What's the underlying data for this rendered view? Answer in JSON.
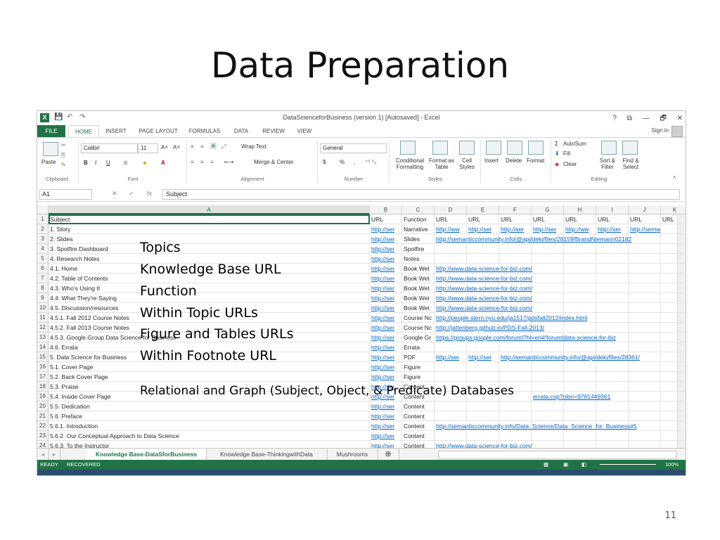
{
  "slide": {
    "title": "Data Preparation",
    "page_number": "11"
  },
  "excel": {
    "window_title": "DataScienceforBusiness (version 1) [Autosaved] - Excel",
    "window_controls": [
      "?",
      "⧉",
      "—",
      "🗗",
      "✕"
    ],
    "ribbon_tabs": [
      "FILE",
      "HOME",
      "INSERT",
      "PAGE LAYOUT",
      "FORMULAS",
      "DATA",
      "REVIEW",
      "VIEW"
    ],
    "active_tab": "HOME",
    "sign_in": "Sign in",
    "ribbon": {
      "clipboard": {
        "label": "Clipboard",
        "paste": "Paste"
      },
      "font": {
        "label": "Font",
        "font_name": "Calibri",
        "font_size": "11",
        "bold": "B",
        "italic": "I",
        "underline": "U"
      },
      "alignment": {
        "label": "Alignment",
        "wrap_text": "Wrap Text",
        "merge_center": "Merge & Center"
      },
      "number": {
        "label": "Number",
        "format": "General",
        "currency": "$",
        "percent": "%",
        "comma": ","
      },
      "styles": {
        "label": "Styles",
        "conditional": "Conditional Formatting",
        "format_table": "Format as Table",
        "cell_styles": "Cell Styles"
      },
      "cells": {
        "label": "Cells",
        "insert": "Insert",
        "delete": "Delete",
        "format": "Format"
      },
      "editing": {
        "label": "Editing",
        "autosum": "AutoSum",
        "fill": "Fill",
        "clear": "Clear",
        "sort_filter": "Sort & Filter",
        "find_select": "Find & Select"
      }
    },
    "formula_bar": {
      "name_box": "A1",
      "fx": "fx",
      "value": "Subject"
    },
    "columns": [
      "A",
      "B",
      "C",
      "D",
      "E",
      "F",
      "G",
      "H",
      "I",
      "J",
      "K"
    ],
    "rows": [
      {
        "n": "1",
        "a": "Subject",
        "b": "URL",
        "c": "Function",
        "d": "URL",
        "e": "URL",
        "f": "URL",
        "g": "URL",
        "h": "URL",
        "i": "URL",
        "j": "URL",
        "k": "URL"
      },
      {
        "n": "2",
        "a": "1. Story",
        "b": "http://ser",
        "c": "Narrative",
        "d": "http://ww",
        "e": "http://ser",
        "f": "http://ser",
        "g": "http://ser",
        "h": "http://ww",
        "i": "http://ser",
        "j": "http://seman"
      },
      {
        "n": "3",
        "a": "2. Slides",
        "b": "http://ser",
        "c": "Slides",
        "d": "http://semanticcommunity.info/@api/deki/files/28159/BrandNiemann02182"
      },
      {
        "n": "4",
        "a": "3. Spotfire Dashboard",
        "b": "http://ser",
        "c": "Spotfire"
      },
      {
        "n": "5",
        "a": "4. Research Notes",
        "b": "http://ser",
        "c": "Notes"
      },
      {
        "n": "6",
        "a": "4.1. Home",
        "b": "http://ser",
        "c": "Book Wet",
        "d": "http://www.data-science-for-biz.com/"
      },
      {
        "n": "7",
        "a": "4.2. Table of Contents",
        "b": "http://ser",
        "c": "Book Wet",
        "d": "http://www.data-science-for-biz.com/"
      },
      {
        "n": "8",
        "a": "4.3. Who's Using It",
        "b": "http://ser",
        "c": "Book Wet",
        "d": "http://www.data-science-for-biz.com/"
      },
      {
        "n": "9",
        "a": "4.4. What They're Saying",
        "b": "http://ser",
        "c": "Book Wet",
        "d": "http://www.data-science-for-biz.com/"
      },
      {
        "n": "10",
        "a": "4.5. Discussion/resources",
        "b": "http://ser",
        "c": "Book Wet",
        "d": "http://www.data-science-for-biz.com/"
      },
      {
        "n": "11",
        "a": "4.5.1. Fall 2012 Course Notes",
        "b": "http://ser",
        "c": "Course Nc",
        "d": "http://people.stern.nyu.edu/ja1517/pdsfall2012/index.html"
      },
      {
        "n": "12",
        "a": "4.5.2. Fall 2013 Course Notes",
        "b": "http://ser",
        "c": "Course Nc",
        "d": "http://jattenberg.github.io/PDS-Fall-2013/"
      },
      {
        "n": "13",
        "a": "4.5.3. Google Group Data Science for Business",
        "b": "http://ser",
        "c": "Google Gr",
        "d": "https://groups.google.com/forum/?hl=en#!forum/data-science-for-biz"
      },
      {
        "n": "14",
        "a": "4.6. Errata",
        "b": "http://ser",
        "c": "Errata"
      },
      {
        "n": "15",
        "a": "5. Data Science for Business",
        "b": "http://ser",
        "c": "PDF",
        "d": "http://ser",
        "e": "http://ser",
        "f": "http://semanticcommunity.info/@api/deki/files/28361/"
      },
      {
        "n": "16",
        "a": "5.1. Cover Page",
        "b": "http://ser",
        "c": "Figure"
      },
      {
        "n": "17",
        "a": "5.2. Back Cover Page",
        "b": "http://ser",
        "c": "Figure"
      },
      {
        "n": "18",
        "a": "5.3. Praise",
        "b": "http://ser",
        "c": "Content"
      },
      {
        "n": "19",
        "a": "5.4. Inside Cover Page",
        "b": "http://ser",
        "c": "Content",
        "g": "errata.csp?isbn=9781449361"
      },
      {
        "n": "20",
        "a": "5.5. Dedication",
        "b": "http://ser",
        "c": "Content"
      },
      {
        "n": "21",
        "a": "5.6. Preface",
        "b": "http://ser",
        "c": "Content"
      },
      {
        "n": "22",
        "a": "5.6.1. Introduction",
        "b": "http://ser",
        "c": "Content",
        "d": "http://semanticcommunity.info/Data_Science/Data_Science_for_Business#5"
      },
      {
        "n": "23",
        "a": "5.6.2. Our Conceptual Approach to Data Science",
        "b": "http://ser",
        "c": "Content"
      },
      {
        "n": "24",
        "a": "5.6.3. To the Instructor",
        "b": "http://ser",
        "c": "Content",
        "d": "http://www.data-science-for-biz.com/"
      }
    ],
    "sheet_tabs": [
      "Knowledge Base-DataSforBusiness",
      "Knowledge Base-ThinkingwithData",
      "Mushrooms"
    ],
    "status": {
      "ready": "READY",
      "recovered": "RECOVERED",
      "zoom": "100%"
    }
  },
  "overlay_labels": [
    "Topics",
    "Knowledge Base URL",
    "Function",
    "Within Topic URLs",
    "Figure and Tables URLs",
    "Within Footnote URL",
    "Relational and Graph (Subject, Object, & Predicate) Databases"
  ]
}
